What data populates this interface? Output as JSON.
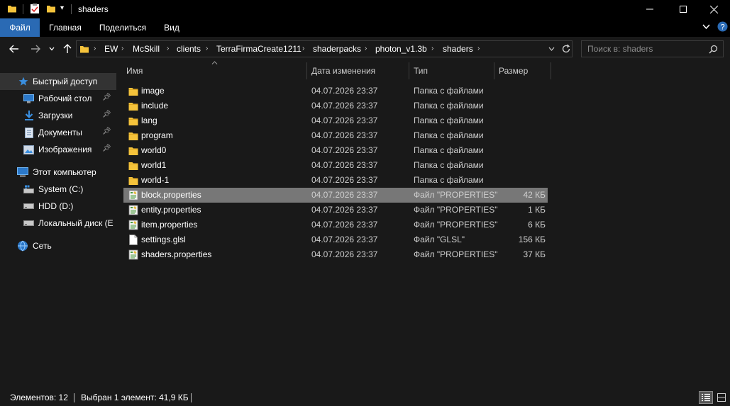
{
  "window": {
    "title": "shaders",
    "minimize": "—",
    "maximize": "☐",
    "close": "✕"
  },
  "ribbon": {
    "tabs": [
      {
        "label": "Файл",
        "active": true
      },
      {
        "label": "Главная",
        "active": false
      },
      {
        "label": "Поделиться",
        "active": false
      },
      {
        "label": "Вид",
        "active": false
      }
    ],
    "expand_icon": "chevron-down-icon",
    "help_icon": "help-icon"
  },
  "navigation": {
    "back": "←",
    "forward": "→",
    "recent": "˅",
    "up": "↑"
  },
  "address": {
    "breadcrumbs": [
      "EW",
      "McSkill",
      "clients",
      "TerraFirmaCreate1211",
      "shaderpacks",
      "photon_v1.3b",
      "shaders"
    ],
    "separator": "›",
    "dropdown": "˅",
    "refresh": "↻"
  },
  "search": {
    "placeholder": "Поиск в: shaders"
  },
  "sidebar": {
    "items": [
      {
        "label": "Быстрый доступ",
        "icon": "star-icon",
        "pinned": false,
        "selected": true
      },
      {
        "label": "Рабочий стол",
        "icon": "desktop-icon",
        "pinned": true,
        "selected": false
      },
      {
        "label": "Загрузки",
        "icon": "download-icon",
        "pinned": true,
        "selected": false
      },
      {
        "label": "Документы",
        "icon": "documents-icon",
        "pinned": true,
        "selected": false
      },
      {
        "label": "Изображения",
        "icon": "pictures-icon",
        "pinned": true,
        "selected": false
      },
      {
        "label": "Этот компьютер",
        "icon": "computer-icon",
        "pinned": false,
        "selected": false
      },
      {
        "label": "System (C:)",
        "icon": "system-drive-icon",
        "pinned": false,
        "selected": false
      },
      {
        "label": "HDD (D:)",
        "icon": "drive-icon",
        "pinned": false,
        "selected": false
      },
      {
        "label": "Локальный диск (E",
        "icon": "drive-icon",
        "pinned": false,
        "selected": false
      },
      {
        "label": "Сеть",
        "icon": "network-icon",
        "pinned": false,
        "selected": false
      }
    ]
  },
  "columns": {
    "name": "Имя",
    "date": "Дата изменения",
    "type": "Тип",
    "size": "Размер"
  },
  "files": [
    {
      "name": "image",
      "date": "04.07.2026 23:37",
      "type": "Папка с файлами",
      "size": "",
      "kind": "folder",
      "selected": false
    },
    {
      "name": "include",
      "date": "04.07.2026 23:37",
      "type": "Папка с файлами",
      "size": "",
      "kind": "folder",
      "selected": false
    },
    {
      "name": "lang",
      "date": "04.07.2026 23:37",
      "type": "Папка с файлами",
      "size": "",
      "kind": "folder",
      "selected": false
    },
    {
      "name": "program",
      "date": "04.07.2026 23:37",
      "type": "Папка с файлами",
      "size": "",
      "kind": "folder",
      "selected": false
    },
    {
      "name": "world0",
      "date": "04.07.2026 23:37",
      "type": "Папка с файлами",
      "size": "",
      "kind": "folder",
      "selected": false
    },
    {
      "name": "world1",
      "date": "04.07.2026 23:37",
      "type": "Папка с файлами",
      "size": "",
      "kind": "folder",
      "selected": false
    },
    {
      "name": "world-1",
      "date": "04.07.2026 23:37",
      "type": "Папка с файлами",
      "size": "",
      "kind": "folder",
      "selected": false
    },
    {
      "name": "block.properties",
      "date": "04.07.2026 23:37",
      "type": "Файл \"PROPERTIES\"",
      "size": "42 КБ",
      "kind": "properties",
      "selected": true
    },
    {
      "name": "entity.properties",
      "date": "04.07.2026 23:37",
      "type": "Файл \"PROPERTIES\"",
      "size": "1 КБ",
      "kind": "properties",
      "selected": false
    },
    {
      "name": "item.properties",
      "date": "04.07.2026 23:37",
      "type": "Файл \"PROPERTIES\"",
      "size": "6 КБ",
      "kind": "properties",
      "selected": false
    },
    {
      "name": "settings.glsl",
      "date": "04.07.2026 23:37",
      "type": "Файл \"GLSL\"",
      "size": "156 КБ",
      "kind": "file",
      "selected": false
    },
    {
      "name": "shaders.properties",
      "date": "04.07.2026 23:37",
      "type": "Файл \"PROPERTIES\"",
      "size": "37 КБ",
      "kind": "properties",
      "selected": false
    }
  ],
  "status": {
    "count": "Элементов: 12",
    "selection": "Выбран 1 элемент: 41,9 КБ"
  },
  "colors": {
    "accent": "#2a6ab4",
    "folder": "#f5c33b",
    "selected_row": "#777777"
  }
}
